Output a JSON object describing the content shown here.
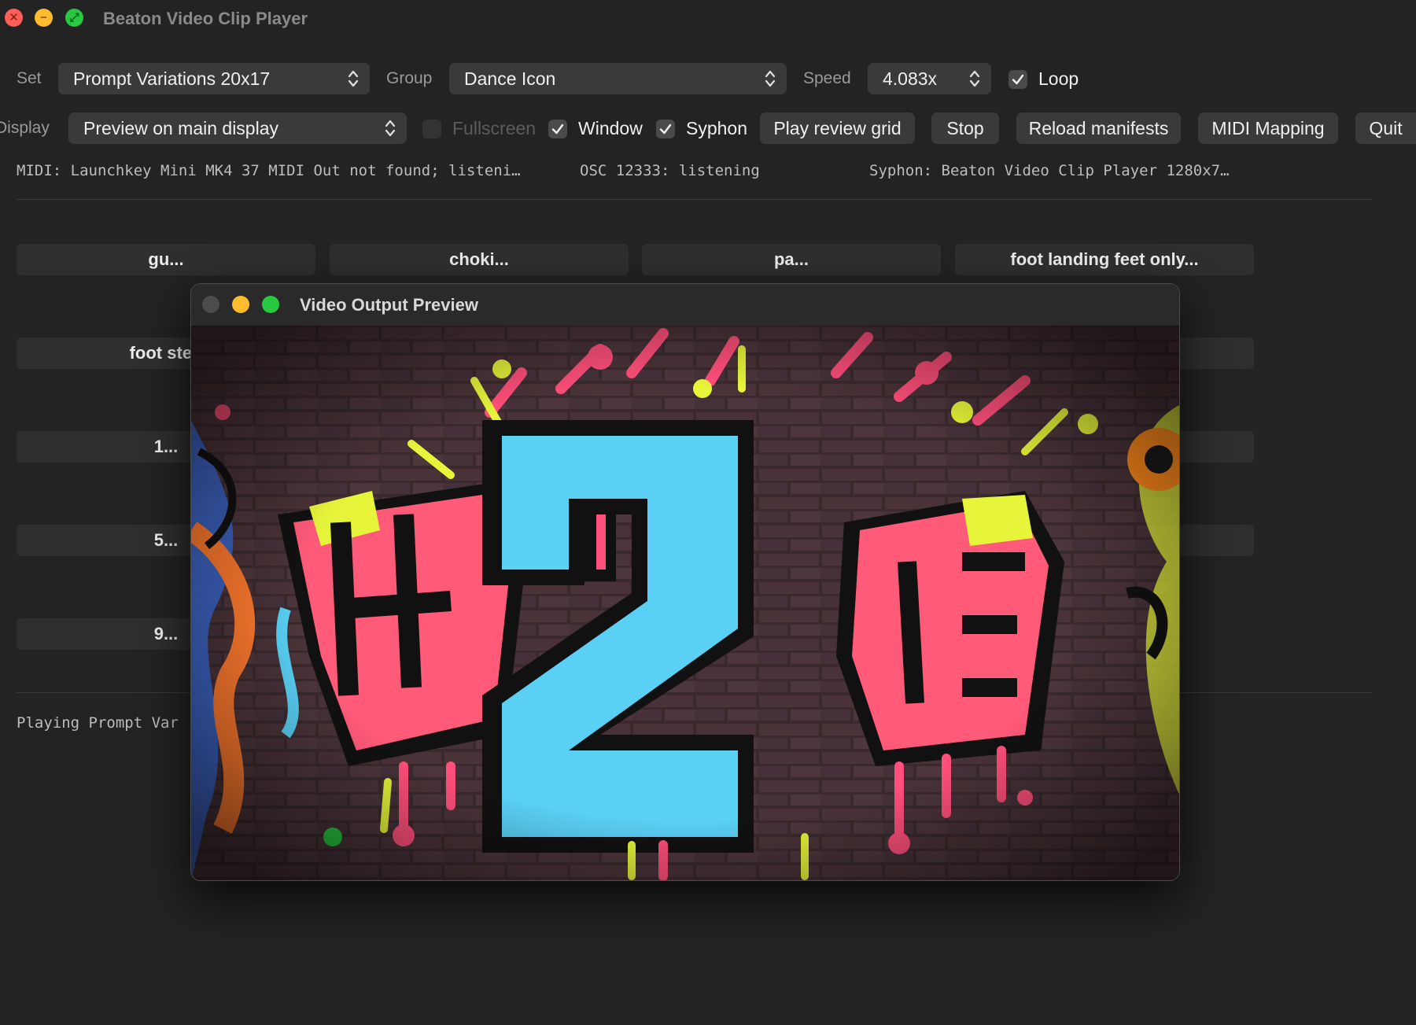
{
  "window": {
    "title": "Beaton Video Clip Player",
    "close_glyph": "✕",
    "minimize_glyph": "−",
    "zoom_glyph": "⤢"
  },
  "controls": {
    "set_label": "Set",
    "set_value": "Prompt Variations 20x17",
    "group_label": "Group",
    "group_value": "Dance Icon",
    "speed_label": "Speed",
    "speed_value": "4.083x",
    "loop_label": "Loop",
    "loop_checked": true,
    "display_label": "Display",
    "display_value": "Preview on main display",
    "fullscreen_label": "Fullscreen",
    "fullscreen_checked": false,
    "window_label": "Window",
    "window_checked": true,
    "syphon_label": "Syphon",
    "syphon_checked": true,
    "play_review_label": "Play review grid",
    "stop_label": "Stop",
    "reload_label": "Reload manifests",
    "midi_mapping_label": "MIDI Mapping",
    "quit_label": "Quit"
  },
  "status": {
    "midi": "MIDI: Launchkey Mini MK4 37 MIDI Out not found; listeni…",
    "osc": "OSC 12333: listening",
    "syphon": "Syphon: Beaton Video Clip Player 1280x7…"
  },
  "grid": {
    "row1": [
      "gu...",
      "choki...",
      "pa...",
      "foot landing feet only..."
    ],
    "row2_first": "foot step fee",
    "row3_first": "1...",
    "row4_first": "5...",
    "row5_first": "9..."
  },
  "footer": {
    "playing": "Playing Prompt Var"
  },
  "preview": {
    "title": "Video Output Preview",
    "icon_name": "graffiti-2-artwork"
  },
  "colors": {
    "background": "#232323",
    "control": "#3a3a3a",
    "grid_button": "#2f2f2f",
    "close": "#ff5f57",
    "minimize": "#febc2e",
    "zoom": "#28c840",
    "graffiti_cyan": "#5ad0f5",
    "graffiti_pink": "#ff4f7a",
    "graffiti_yellow": "#e6f53a"
  }
}
